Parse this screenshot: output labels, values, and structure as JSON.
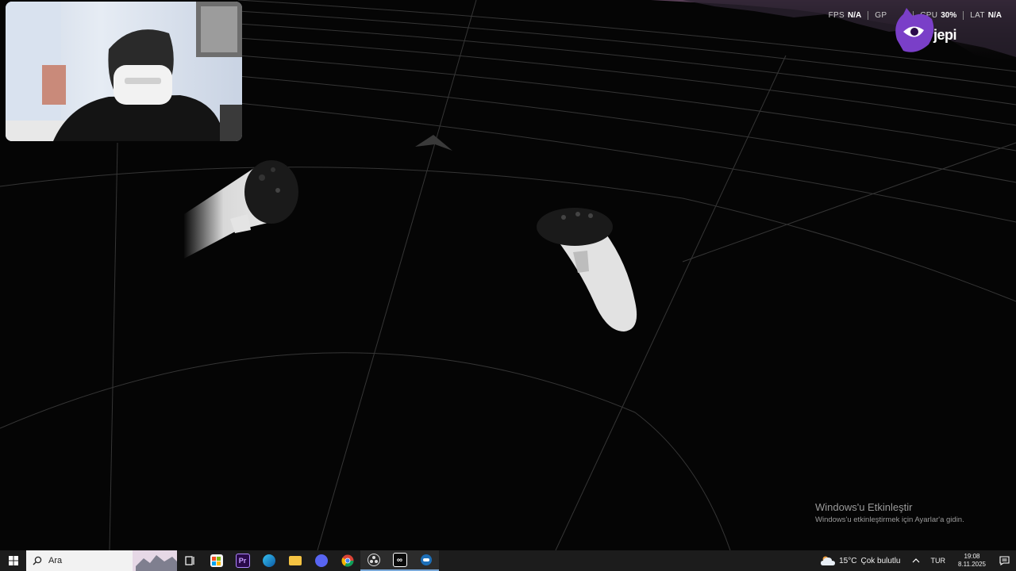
{
  "hud": {
    "items": [
      {
        "label": "FPS",
        "value": "N/A"
      },
      {
        "label": "GP",
        "value": ""
      },
      {
        "label": "CPU",
        "value": "30%"
      },
      {
        "label": "LAT",
        "value": "N/A"
      }
    ]
  },
  "logo": {
    "text": "jepi"
  },
  "activation": {
    "title": "Windows'u Etkinleştir",
    "subtitle": "Windows'u etkinleştirmek için Ayarlar'a gidin."
  },
  "taskbar": {
    "search_placeholder": "Ara",
    "apps": [
      "start",
      "task-view",
      "store",
      "premiere-pro",
      "edge",
      "file-explorer",
      "discord",
      "chrome",
      "obs",
      "meta-horizon",
      "oculus"
    ],
    "active_apps": [
      "obs",
      "meta-horizon",
      "oculus"
    ]
  },
  "tray": {
    "temperature": "15°C",
    "weather": "Çok bulutlu",
    "language": "TUR",
    "time": "19:08",
    "date": "8.11.2025"
  },
  "colors": {
    "background": "#050505",
    "taskbar": "#1c1c1c",
    "grid_line": "#5a5a5a",
    "logo_purple": "#7a3fc8"
  }
}
